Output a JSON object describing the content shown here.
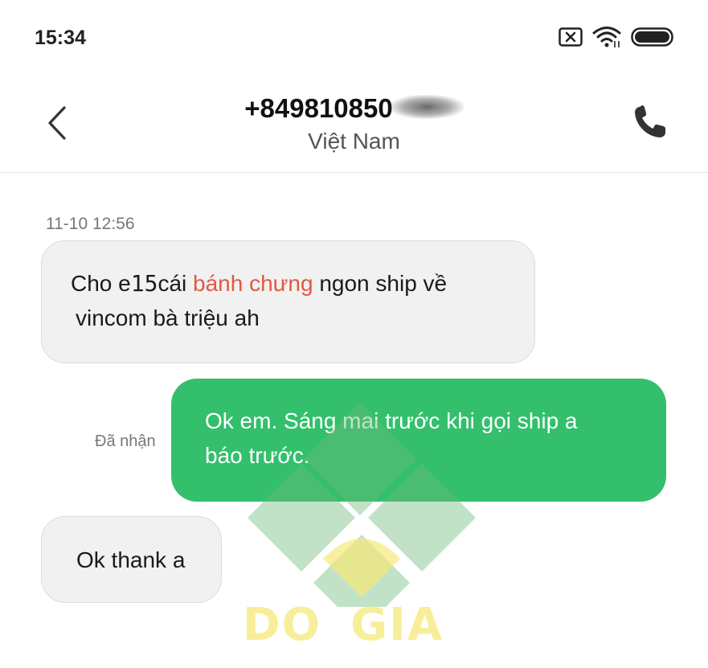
{
  "status_bar": {
    "time": "15:34",
    "icons": [
      "sim-off-icon",
      "wifi-icon",
      "battery-icon"
    ]
  },
  "header": {
    "contact_number": "+849810850",
    "contact_country": "Việt Nam",
    "icons": [
      "back-arrow-icon",
      "phone-icon"
    ]
  },
  "conversation": {
    "timestamp": "11-10 12:56",
    "messages": [
      {
        "direction": "incoming",
        "segments": {
          "prefix": "Cho e",
          "quantity": "15",
          "mid": "cái ",
          "highlight": "bánh chưng",
          "suffix": " ngon ship về",
          "line2": "vincom bà triệu ah"
        }
      },
      {
        "direction": "outgoing",
        "status": "Đã nhận",
        "line1": "Ok em. Sáng mai trước khi gọi ship a",
        "line2": "báo trước."
      },
      {
        "direction": "incoming",
        "text": "Ok thank a"
      }
    ]
  },
  "watermark": {
    "word1": "DO",
    "word2": "GIA"
  },
  "colors": {
    "outgoing_bubble": "#33bf6c",
    "incoming_bubble": "#f1f1f1",
    "highlight_text": "#e05a40"
  }
}
